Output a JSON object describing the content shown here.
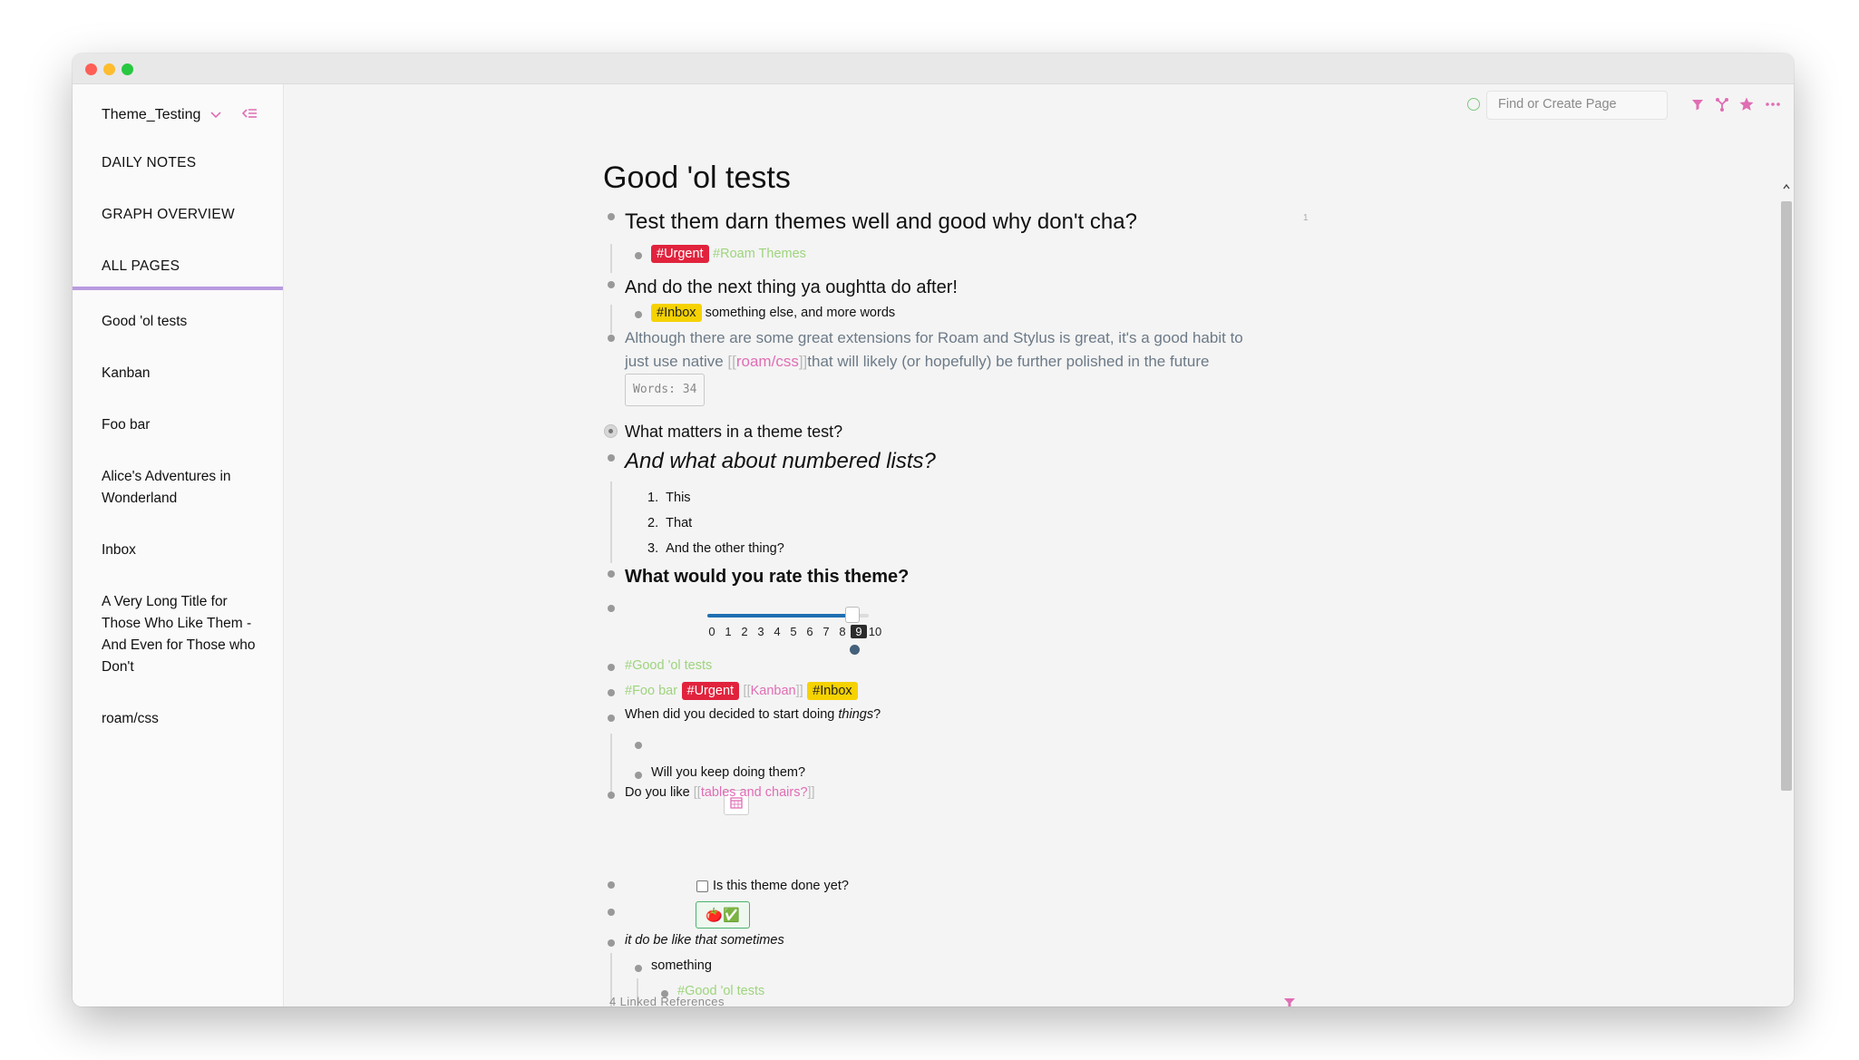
{
  "sidebar": {
    "graph_name": "Theme_Testing",
    "nav": [
      "DAILY NOTES",
      "GRAPH OVERVIEW",
      "ALL PAGES"
    ],
    "shortcuts": [
      "Good 'ol tests",
      "Kanban",
      "Foo bar",
      "Alice's Adventures in Wonderland",
      "Inbox",
      "A Very Long Title for Those Who Like Them - And Even for Those who Don't",
      "roam/css"
    ]
  },
  "topbar": {
    "search_placeholder": "Find or Create Page",
    "icons": [
      "sync-status-icon",
      "filter-icon",
      "graph-icon",
      "star-icon",
      "more-icon"
    ],
    "accent_color": "#e06db4"
  },
  "page": {
    "title": "Good 'ol tests",
    "block_ref_count": "1",
    "b1": "Test them darn themes well and good why don't cha?",
    "b1_tag_urgent": "#Urgent",
    "b1_tag_roam": "#Roam Themes",
    "b2": "And do the next thing ya oughtta do after!",
    "b2_tag_inbox": "#Inbox",
    "b2_text": "something else, and more words",
    "b3_pre": "Although there are some great extensions for Roam and Stylus is great, it's a good habit to just use native ",
    "b3_link_open": "[[",
    "b3_link": "roam/css",
    "b3_link_close": "]]",
    "b3_post": "that will likely (or hopefully) be further polished in the future",
    "b3_wordcount": "Words: 34",
    "b4": "What matters in a theme test?",
    "b5": "And what about numbered lists?",
    "numbered": [
      "This",
      "That",
      "And the other thing?"
    ],
    "b6": "What would you rate this theme?",
    "slider": {
      "labels": [
        "0",
        "1",
        "2",
        "3",
        "4",
        "5",
        "6",
        "7",
        "8",
        "9",
        "10"
      ],
      "value": 9,
      "max": 10
    },
    "b7_tag": "#Good 'ol tests",
    "b8_tag_foo": "#Foo bar",
    "b8_tag_urgent": "#Urgent",
    "b8_link_open": "[[",
    "b8_link": "Kanban",
    "b8_link_close": "]]",
    "b8_tag_inbox": "#Inbox",
    "b9_pre": "When did you decided to start doing ",
    "b9_em": "things",
    "b9_post": "?",
    "b9_child": "Will you keep doing them?",
    "b10_pre": "Do you like ",
    "b10_link_open": "[[",
    "b10_link": "tables and chairs?",
    "b10_link_close": "]]",
    "b11": "Is this theme done yet?",
    "b12_emoji": "🍅✅",
    "b13": "it do be like that sometimes",
    "b13_child": "something",
    "b13_grandchild": "#Good 'ol tests",
    "linked_refs": "4 Linked References"
  },
  "colors": {
    "urgent": "#e1233d",
    "inbox": "#f5d200",
    "tag_green": "#9ed47d",
    "link": "#e06db4",
    "slider_fill": "#1f6fb2",
    "sidebar_divider": "#b89be0"
  }
}
